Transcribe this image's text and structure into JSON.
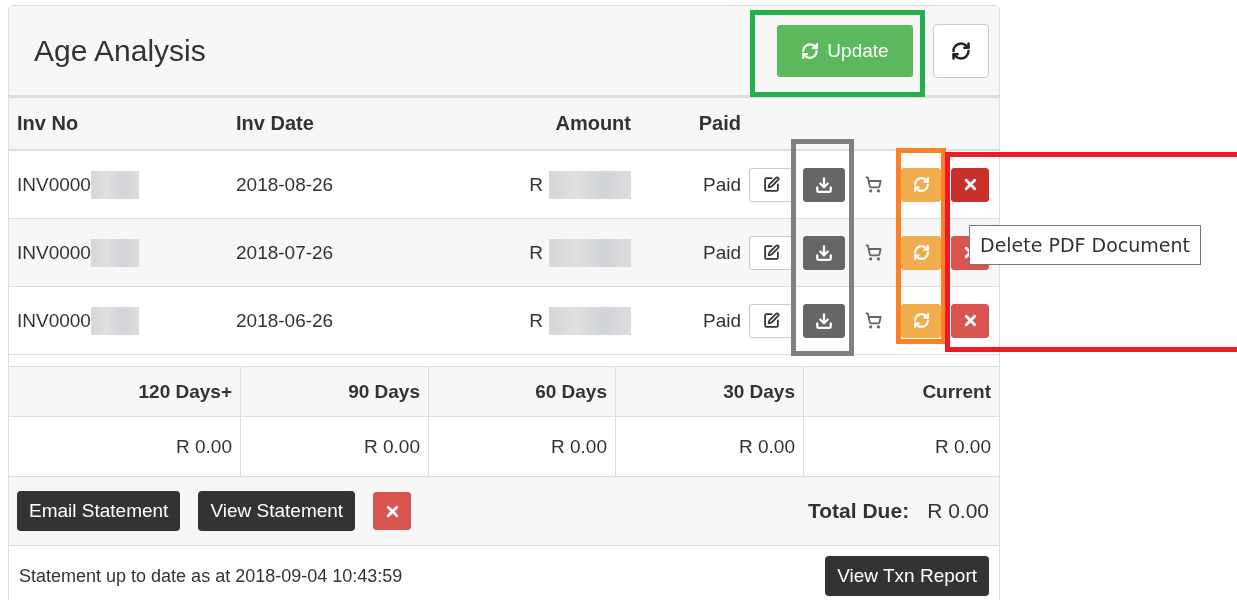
{
  "panel": {
    "title": "Age Analysis",
    "update_button": "Update"
  },
  "invoice_table": {
    "columns": [
      "Inv No",
      "Inv Date",
      "Amount",
      "Paid"
    ],
    "rows": [
      {
        "inv_no": "INV0000",
        "date": "2018-08-26",
        "amount": "R",
        "paid": "Paid"
      },
      {
        "inv_no": "INV0000",
        "date": "2018-07-26",
        "amount": "R",
        "paid": "Paid"
      },
      {
        "inv_no": "INV0000",
        "date": "2018-06-26",
        "amount": "R",
        "paid": "Paid"
      }
    ]
  },
  "aging_table": {
    "columns": [
      "120 Days+",
      "90 Days",
      "60 Days",
      "30 Days",
      "Current"
    ],
    "values": [
      "R 0.00",
      "R 0.00",
      "R 0.00",
      "R 0.00",
      "R 0.00"
    ]
  },
  "footer": {
    "buttons": [
      "Email Statement",
      "View Statement"
    ],
    "total_label": "Total Due:",
    "total_value": "R 0.00"
  },
  "status": {
    "text": "Statement up to date as at 2018-09-04 10:43:59",
    "report_button": "View Txn Report"
  },
  "tooltip": "Delete PDF Document",
  "highlights": [
    {
      "color": "#22b04a"
    },
    {
      "color": "#808080"
    },
    {
      "color": "#ff7f27"
    },
    {
      "color": "#ed1c24"
    }
  ]
}
